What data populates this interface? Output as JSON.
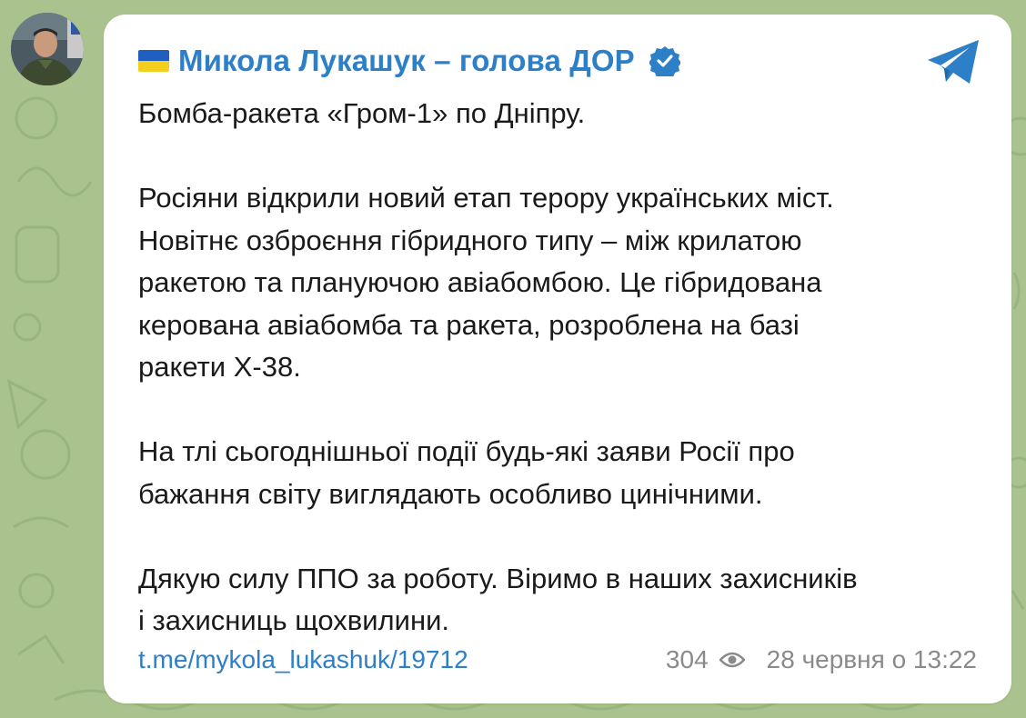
{
  "channel": {
    "name": "Микола Лукашук – голова ДОР",
    "flag_icon": "ukraine-flag-icon",
    "verified_icon": "verified-badge-icon"
  },
  "message": {
    "paragraphs": [
      [
        "Бомба-ракета «Гром-1» по Дніпру."
      ],
      [
        "Росіяни відкрили новий етап терору українських міст.",
        "Новітнє озброєння гібридного типу – між крилатою",
        "ракетою та плануючою авіабомбою. Це гібридована",
        "керована авіабомба та ракета, розроблена на базі",
        "ракети Х-38."
      ],
      [
        "На тлі сьогоднішньої події будь-які заяви Росії про",
        "бажання світу виглядають особливо цинічними."
      ],
      [
        "Дякую силу ППО за роботу. Віримо в наших захисників",
        "і захисниць щохвилини."
      ]
    ]
  },
  "footer": {
    "link": "t.me/mykola_lukashuk/19712",
    "views": "304",
    "date": "28 червня о 13:22"
  },
  "colors": {
    "accent": "#2d7fc7",
    "background": "#a9c28e",
    "bubble": "#ffffff",
    "meta": "#8a8a8a"
  }
}
